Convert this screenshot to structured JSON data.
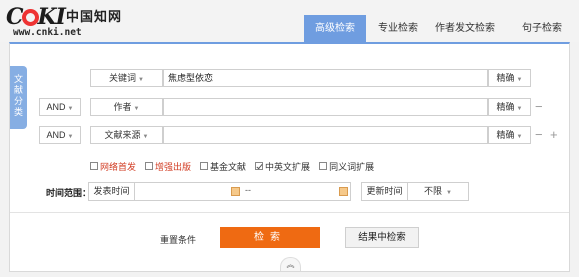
{
  "logo": {
    "brand": "CNKI",
    "cn_text": "中国知网",
    "url": "www.cnki.net"
  },
  "tabs": [
    {
      "label": "高级检索",
      "active": true
    },
    {
      "label": "专业检索",
      "active": false
    },
    {
      "label": "作者发文检索",
      "active": false
    },
    {
      "label": "句子检索",
      "active": false
    }
  ],
  "side_tab": [
    "文",
    "献",
    "分",
    "类"
  ],
  "rows": [
    {
      "logic": "",
      "field": "关键词",
      "value": "焦虑型依恋",
      "match": "精确"
    },
    {
      "logic": "AND",
      "field": "作者",
      "value": "",
      "match": "精确"
    },
    {
      "logic": "AND",
      "field": "文献来源",
      "value": "",
      "match": "精确"
    }
  ],
  "checkboxes": [
    {
      "label": "网络首发",
      "checked": false,
      "red": true
    },
    {
      "label": "增强出版",
      "checked": false,
      "red": true
    },
    {
      "label": "基金文献",
      "checked": false,
      "red": false
    },
    {
      "label": "中英文扩展",
      "checked": true,
      "red": false
    },
    {
      "label": "同义词扩展",
      "checked": false,
      "red": false
    }
  ],
  "time": {
    "label": "时间范围：",
    "publish_label": "发表时间",
    "separator": "--",
    "update_label": "更新时间",
    "update_value": "不限"
  },
  "actions": {
    "reset": "重置条件",
    "search": "检索",
    "search_in_results": "结果中检索"
  },
  "colors": {
    "accent": "#6f9de0",
    "search_button": "#ef6a12",
    "red_option": "#d23c23"
  }
}
